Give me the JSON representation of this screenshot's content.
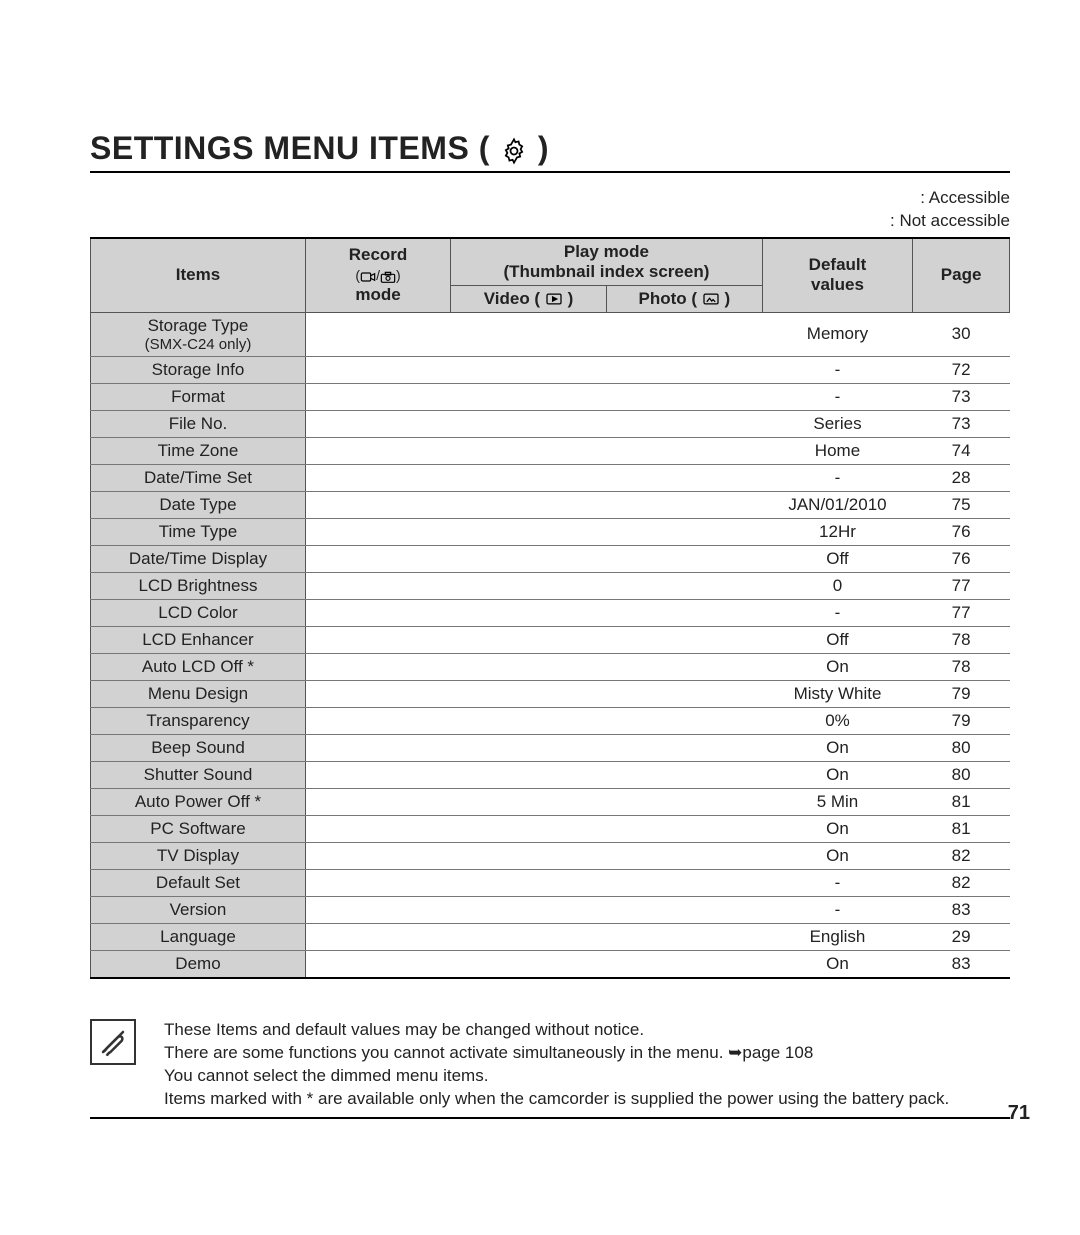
{
  "title": "SETTINGS MENU ITEMS (",
  "title_suffix": " )",
  "legend": {
    "accessible": ": Accessible",
    "not_accessible": ": Not accessible"
  },
  "columns": {
    "items": "Items",
    "record_top": "Record",
    "record_bottom": "mode",
    "play_top": "Play mode",
    "play_sub": "(Thumbnail index screen)",
    "video": "Video (",
    "video_suffix": " )",
    "photo": "Photo (",
    "photo_suffix": " )",
    "default_top": "Default",
    "default_bottom": "values",
    "page": "Page"
  },
  "rows": [
    {
      "item": "Storage Type",
      "sub": "(SMX-C24 only)",
      "def": "Memory",
      "page": "30"
    },
    {
      "item": "Storage Info",
      "def": "-",
      "page": "72"
    },
    {
      "item": "Format",
      "def": "-",
      "page": "73"
    },
    {
      "item": "File No.",
      "def": "Series",
      "page": "73"
    },
    {
      "item": "Time Zone",
      "def": "Home",
      "page": "74"
    },
    {
      "item": "Date/Time Set",
      "def": "-",
      "page": "28"
    },
    {
      "item": "Date Type",
      "def": "JAN/01/2010",
      "page": "75"
    },
    {
      "item": "Time Type",
      "def": "12Hr",
      "page": "76"
    },
    {
      "item": "Date/Time Display",
      "def": "Off",
      "page": "76"
    },
    {
      "item": "LCD Brightness",
      "def": "0",
      "page": "77"
    },
    {
      "item": "LCD Color",
      "def": "-",
      "page": "77"
    },
    {
      "item": "LCD Enhancer",
      "def": "Off",
      "page": "78"
    },
    {
      "item": "Auto LCD Off *",
      "def": "On",
      "page": "78"
    },
    {
      "item": "Menu Design",
      "def": "Misty White",
      "page": "79"
    },
    {
      "item": "Transparency",
      "def": "0%",
      "page": "79"
    },
    {
      "item": "Beep Sound",
      "def": "On",
      "page": "80"
    },
    {
      "item": "Shutter Sound",
      "def": "On",
      "page": "80"
    },
    {
      "item": "Auto Power Off *",
      "def": "5 Min",
      "page": "81"
    },
    {
      "item": "PC Software",
      "def": "On",
      "page": "81"
    },
    {
      "item": "TV Display",
      "def": "On",
      "page": "82"
    },
    {
      "item": "Default Set",
      "def": "-",
      "page": "82"
    },
    {
      "item": "Version",
      "def": "-",
      "page": "83"
    },
    {
      "item": "Language",
      "def": "English",
      "page": "29"
    },
    {
      "item": "Demo",
      "def": "On",
      "page": "83"
    }
  ],
  "notes": [
    "These Items and default values may be changed without notice.",
    "There are some functions you cannot activate simultaneously in the menu. ➥page 108",
    "You cannot select the dimmed menu items.",
    "Items marked with * are available only when the camcorder is supplied the power using the battery pack."
  ],
  "page_number": "71"
}
